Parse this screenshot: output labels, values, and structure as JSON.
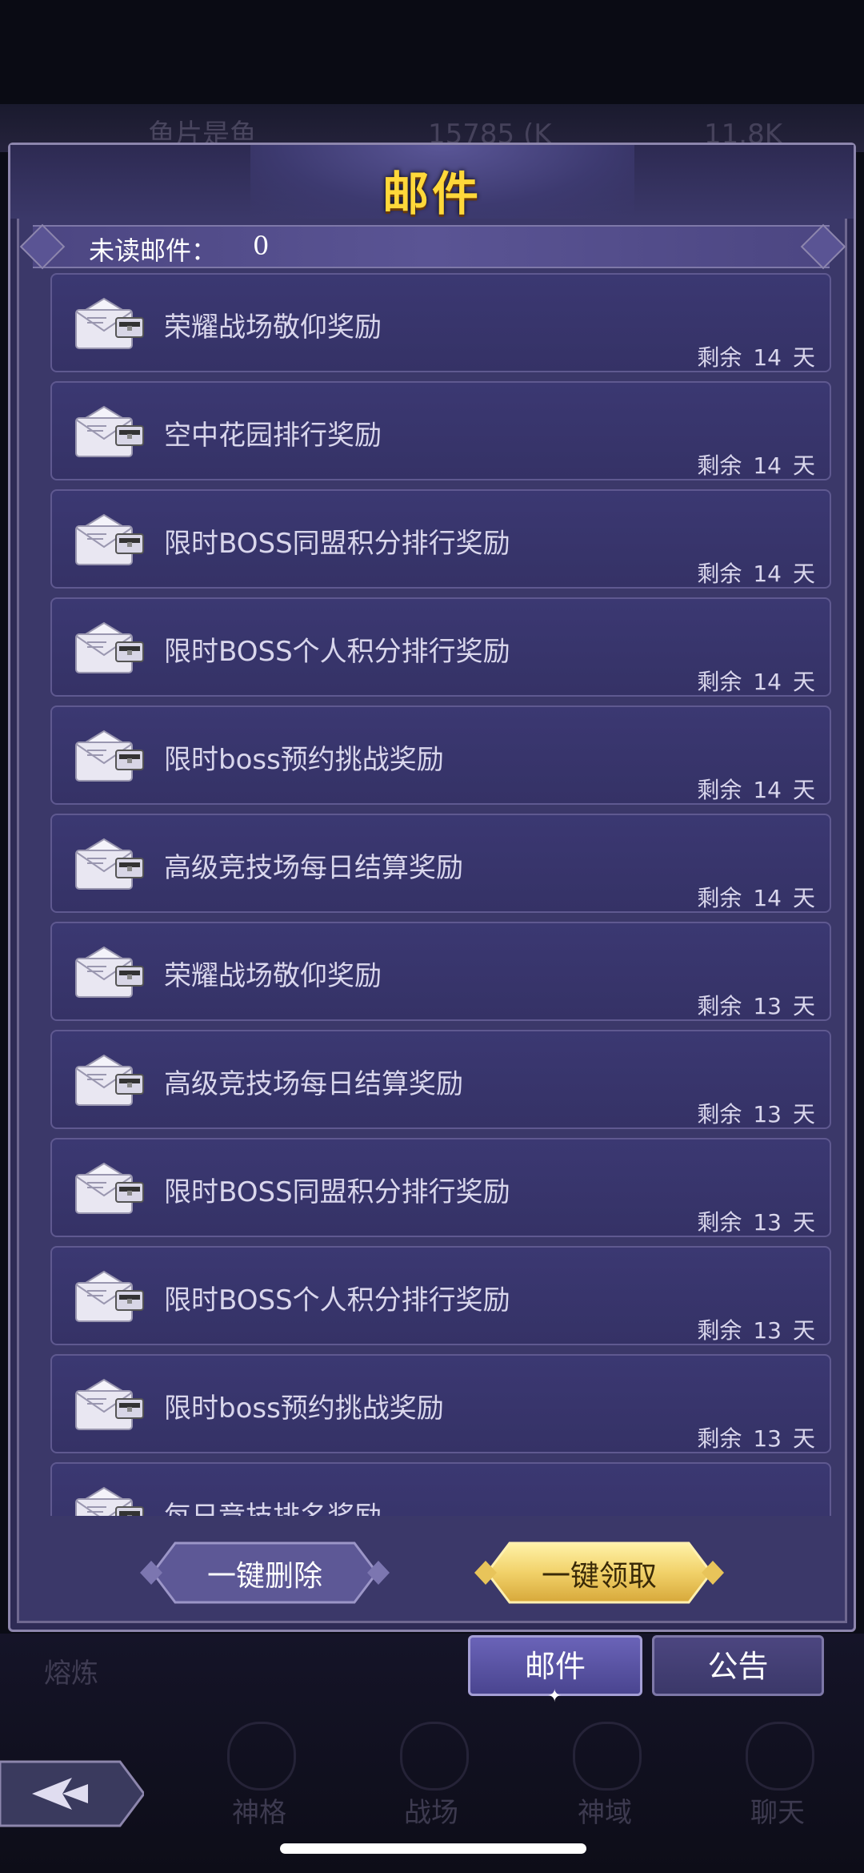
{
  "background": {
    "player_name": "鱼片是鱼",
    "resource_1": "15785 (K",
    "resource_2": "11.8K",
    "side_label": "熔炼"
  },
  "panel": {
    "title": "邮件",
    "unread_label": "未读邮件：",
    "unread_count": "0"
  },
  "mails": [
    {
      "subject": "荣耀战场敬仰奖励",
      "remain_prefix": "剩余",
      "days": "14",
      "unit": "天"
    },
    {
      "subject": "空中花园排行奖励",
      "remain_prefix": "剩余",
      "days": "14",
      "unit": "天"
    },
    {
      "subject": "限时BOSS同盟积分排行奖励",
      "remain_prefix": "剩余",
      "days": "14",
      "unit": "天"
    },
    {
      "subject": "限时BOSS个人积分排行奖励",
      "remain_prefix": "剩余",
      "days": "14",
      "unit": "天"
    },
    {
      "subject": "限时boss预约挑战奖励",
      "remain_prefix": "剩余",
      "days": "14",
      "unit": "天"
    },
    {
      "subject": "高级竞技场每日结算奖励",
      "remain_prefix": "剩余",
      "days": "14",
      "unit": "天"
    },
    {
      "subject": "荣耀战场敬仰奖励",
      "remain_prefix": "剩余",
      "days": "13",
      "unit": "天"
    },
    {
      "subject": "高级竞技场每日结算奖励",
      "remain_prefix": "剩余",
      "days": "13",
      "unit": "天"
    },
    {
      "subject": "限时BOSS同盟积分排行奖励",
      "remain_prefix": "剩余",
      "days": "13",
      "unit": "天"
    },
    {
      "subject": "限时BOSS个人积分排行奖励",
      "remain_prefix": "剩余",
      "days": "13",
      "unit": "天"
    },
    {
      "subject": "限时boss预约挑战奖励",
      "remain_prefix": "剩余",
      "days": "13",
      "unit": "天"
    },
    {
      "subject": "每日竞技排名奖励",
      "remain_prefix": "",
      "days": "",
      "unit": ""
    }
  ],
  "actions": {
    "delete_all": "一键删除",
    "claim_all": "一键领取"
  },
  "tabs": {
    "mail": "邮件",
    "notice": "公告"
  },
  "bottom_nav": [
    "神格",
    "战场",
    "神域",
    "聊天"
  ],
  "icons": {
    "mail_item": "envelope-chest-icon",
    "back": "back-arrow-icon"
  }
}
